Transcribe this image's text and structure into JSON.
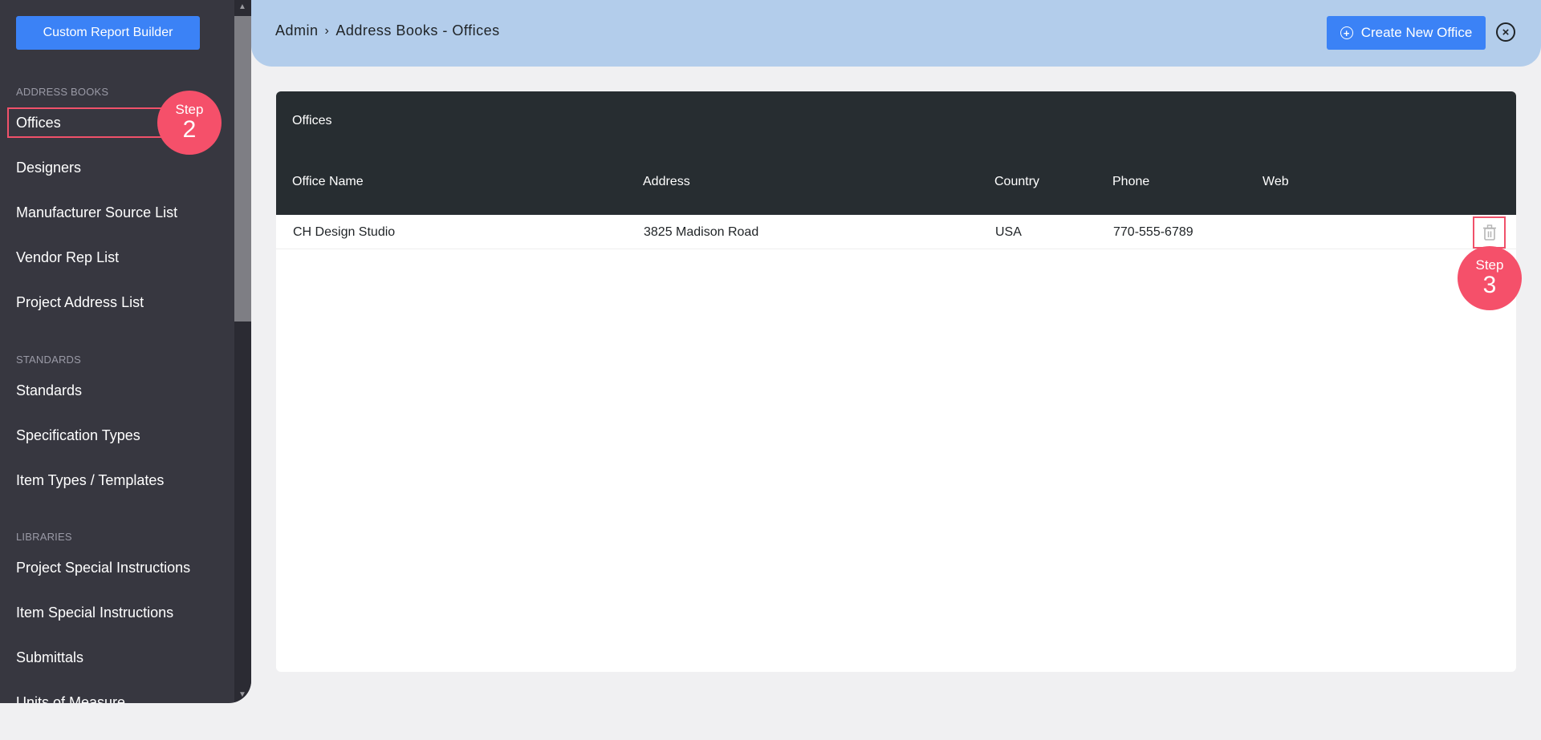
{
  "sidebar": {
    "report_button": "Custom Report Builder",
    "sections": [
      {
        "label": "ADDRESS BOOKS",
        "items": [
          "Offices",
          "Designers",
          "Manufacturer Source List",
          "Vendor Rep List",
          "Project Address List"
        ]
      },
      {
        "label": "STANDARDS",
        "items": [
          "Standards",
          "Specification Types",
          "Item Types / Templates"
        ]
      },
      {
        "label": "LIBRARIES",
        "items": [
          "Project Special Instructions",
          "Item Special Instructions",
          "Submittals",
          "Units of Measure"
        ]
      }
    ],
    "active_item": "Offices"
  },
  "header": {
    "breadcrumb_root": "Admin",
    "breadcrumb_separator": "›",
    "breadcrumb_current": "Address Books - Offices",
    "create_button": "Create New Office",
    "plus_glyph": "+",
    "close_glyph": "×"
  },
  "table": {
    "title": "Offices",
    "columns": [
      "Office Name",
      "Address",
      "Country",
      "Phone",
      "Web"
    ],
    "rows": [
      {
        "office_name": "CH Design Studio",
        "address": "3825 Madison Road",
        "country": "USA",
        "phone": "770-555-6789",
        "web": ""
      }
    ]
  },
  "annotations": {
    "step2": {
      "word": "Step",
      "number": "2"
    },
    "step3": {
      "word": "Step",
      "number": "3"
    }
  },
  "colors": {
    "accent": "#3b82f6",
    "annotation": "#f5506a",
    "sidebar_bg": "#373740",
    "header_bg": "#b3cdeb",
    "table_head_bg": "#272d31"
  }
}
